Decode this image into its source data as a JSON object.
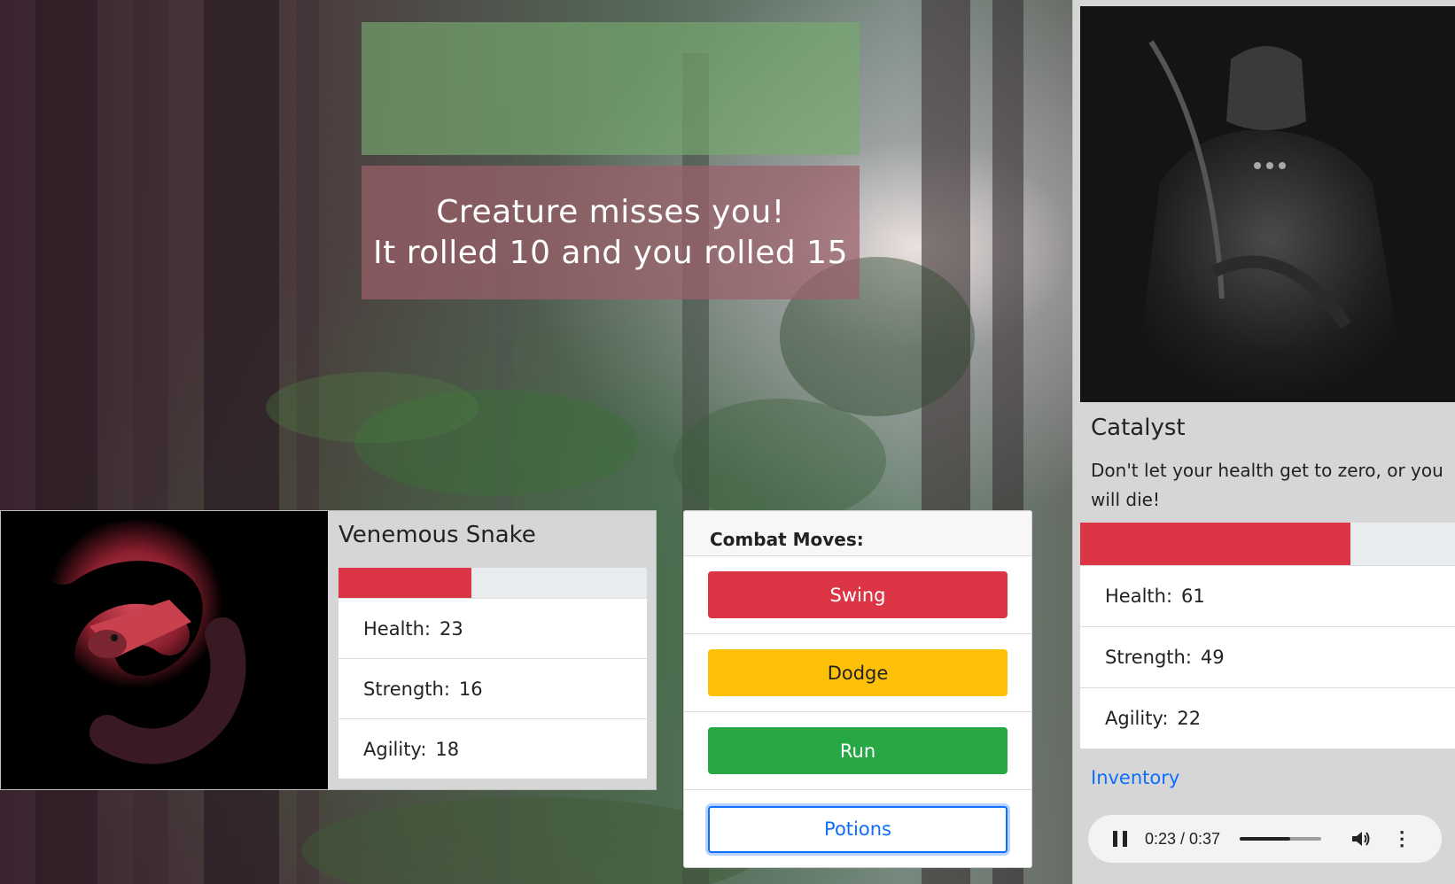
{
  "message": {
    "line1": "Creature misses you!",
    "line2": "It rolled 10 and you rolled 15"
  },
  "enemy": {
    "name": "Venemous Snake",
    "health_fraction": 0.43,
    "stats": [
      {
        "label": "Health:",
        "value": "23"
      },
      {
        "label": "Strength:",
        "value": "16"
      },
      {
        "label": "Agility:",
        "value": "18"
      }
    ]
  },
  "combat": {
    "title": "Combat Moves:",
    "moves": [
      "Swing",
      "Dodge",
      "Run",
      "Potions"
    ]
  },
  "player": {
    "name": "Catalyst",
    "description": "Don't let your health get to zero, or you will die!",
    "health_fraction": 0.72,
    "stats": [
      {
        "label": "Health:",
        "value": "61"
      },
      {
        "label": "Strength:",
        "value": "49"
      },
      {
        "label": "Agility:",
        "value": "22"
      }
    ],
    "inventory_label": "Inventory"
  },
  "audio": {
    "time": "0:23 / 0:37",
    "progress": 0.62
  },
  "colors": {
    "danger": "#dc3545",
    "warning": "#ffc107",
    "success": "#28a745",
    "primary": "#0d6efd"
  }
}
